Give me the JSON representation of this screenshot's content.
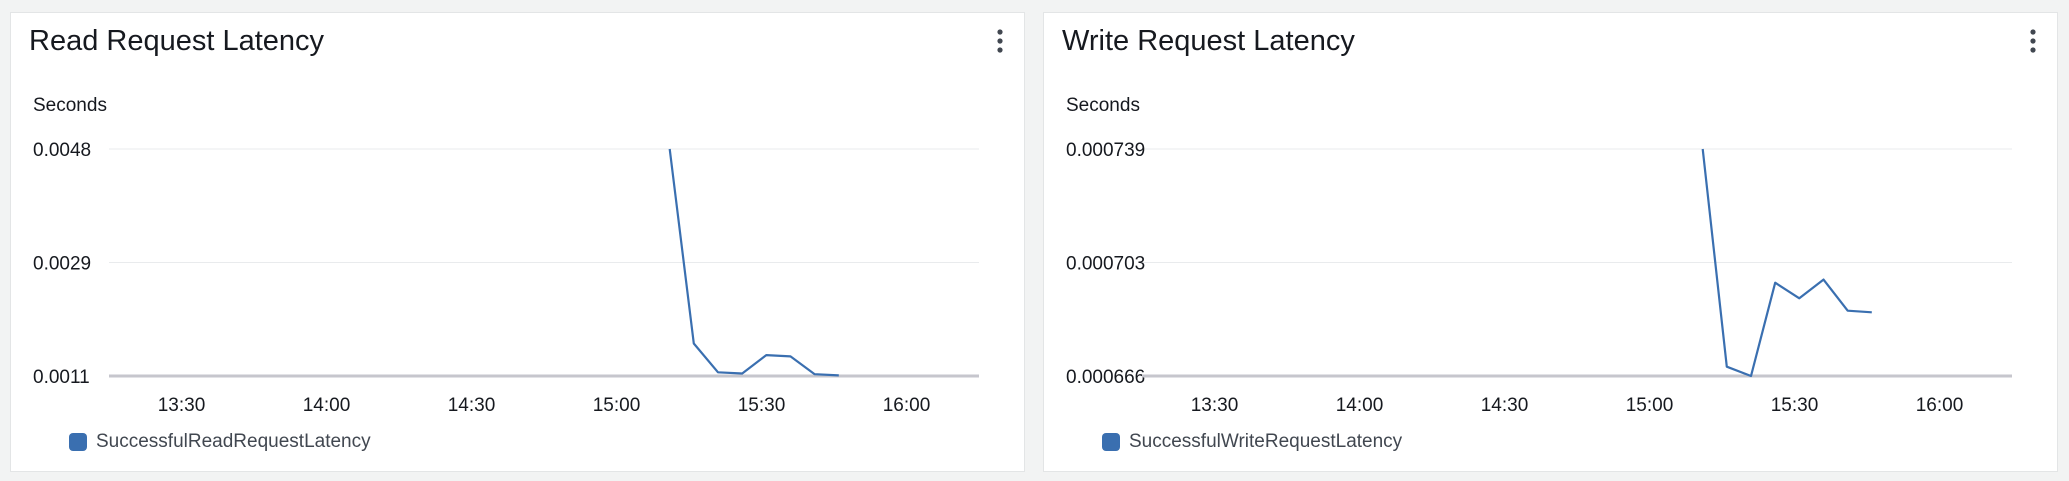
{
  "chart_data": [
    {
      "type": "line",
      "title": "Read Request Latency",
      "ylabel": "Seconds",
      "yticks": [
        "0.0048",
        "0.0029",
        "0.0011"
      ],
      "ylim": [
        0.0011,
        0.0048
      ],
      "xticks": [
        "13:30",
        "14:00",
        "14:30",
        "15:00",
        "15:30",
        "16:00"
      ],
      "xtick_minutes": [
        810,
        840,
        870,
        900,
        930,
        960
      ],
      "xlim_minutes": [
        795,
        975
      ],
      "grid": true,
      "color": "#3a6fb0",
      "series": [
        {
          "name": "SuccessfulReadRequestLatency",
          "x": [
            911,
            916,
            921,
            926,
            931,
            936,
            941,
            946
          ],
          "y": [
            0.0048,
            0.00163,
            0.00116,
            0.00114,
            0.00144,
            0.00142,
            0.00113,
            0.00111
          ]
        }
      ]
    },
    {
      "type": "line",
      "title": "Write Request Latency",
      "ylabel": "Seconds",
      "yticks": [
        "0.000739",
        "0.000703",
        "0.000666"
      ],
      "ylim": [
        0.000666,
        0.000739
      ],
      "xticks": [
        "13:30",
        "14:00",
        "14:30",
        "15:00",
        "15:30",
        "16:00"
      ],
      "xtick_minutes": [
        810,
        840,
        870,
        900,
        930,
        960
      ],
      "xlim_minutes": [
        795,
        975
      ],
      "grid": true,
      "color": "#3a6fb0",
      "series": [
        {
          "name": "SuccessfulWriteRequestLatency",
          "x": [
            911,
            916,
            921,
            926,
            931,
            936,
            941,
            946
          ],
          "y": [
            0.000739,
            0.000669,
            0.000666,
            0.000696,
            0.000691,
            0.000697,
            0.000687,
            0.0006865
          ]
        }
      ]
    }
  ]
}
